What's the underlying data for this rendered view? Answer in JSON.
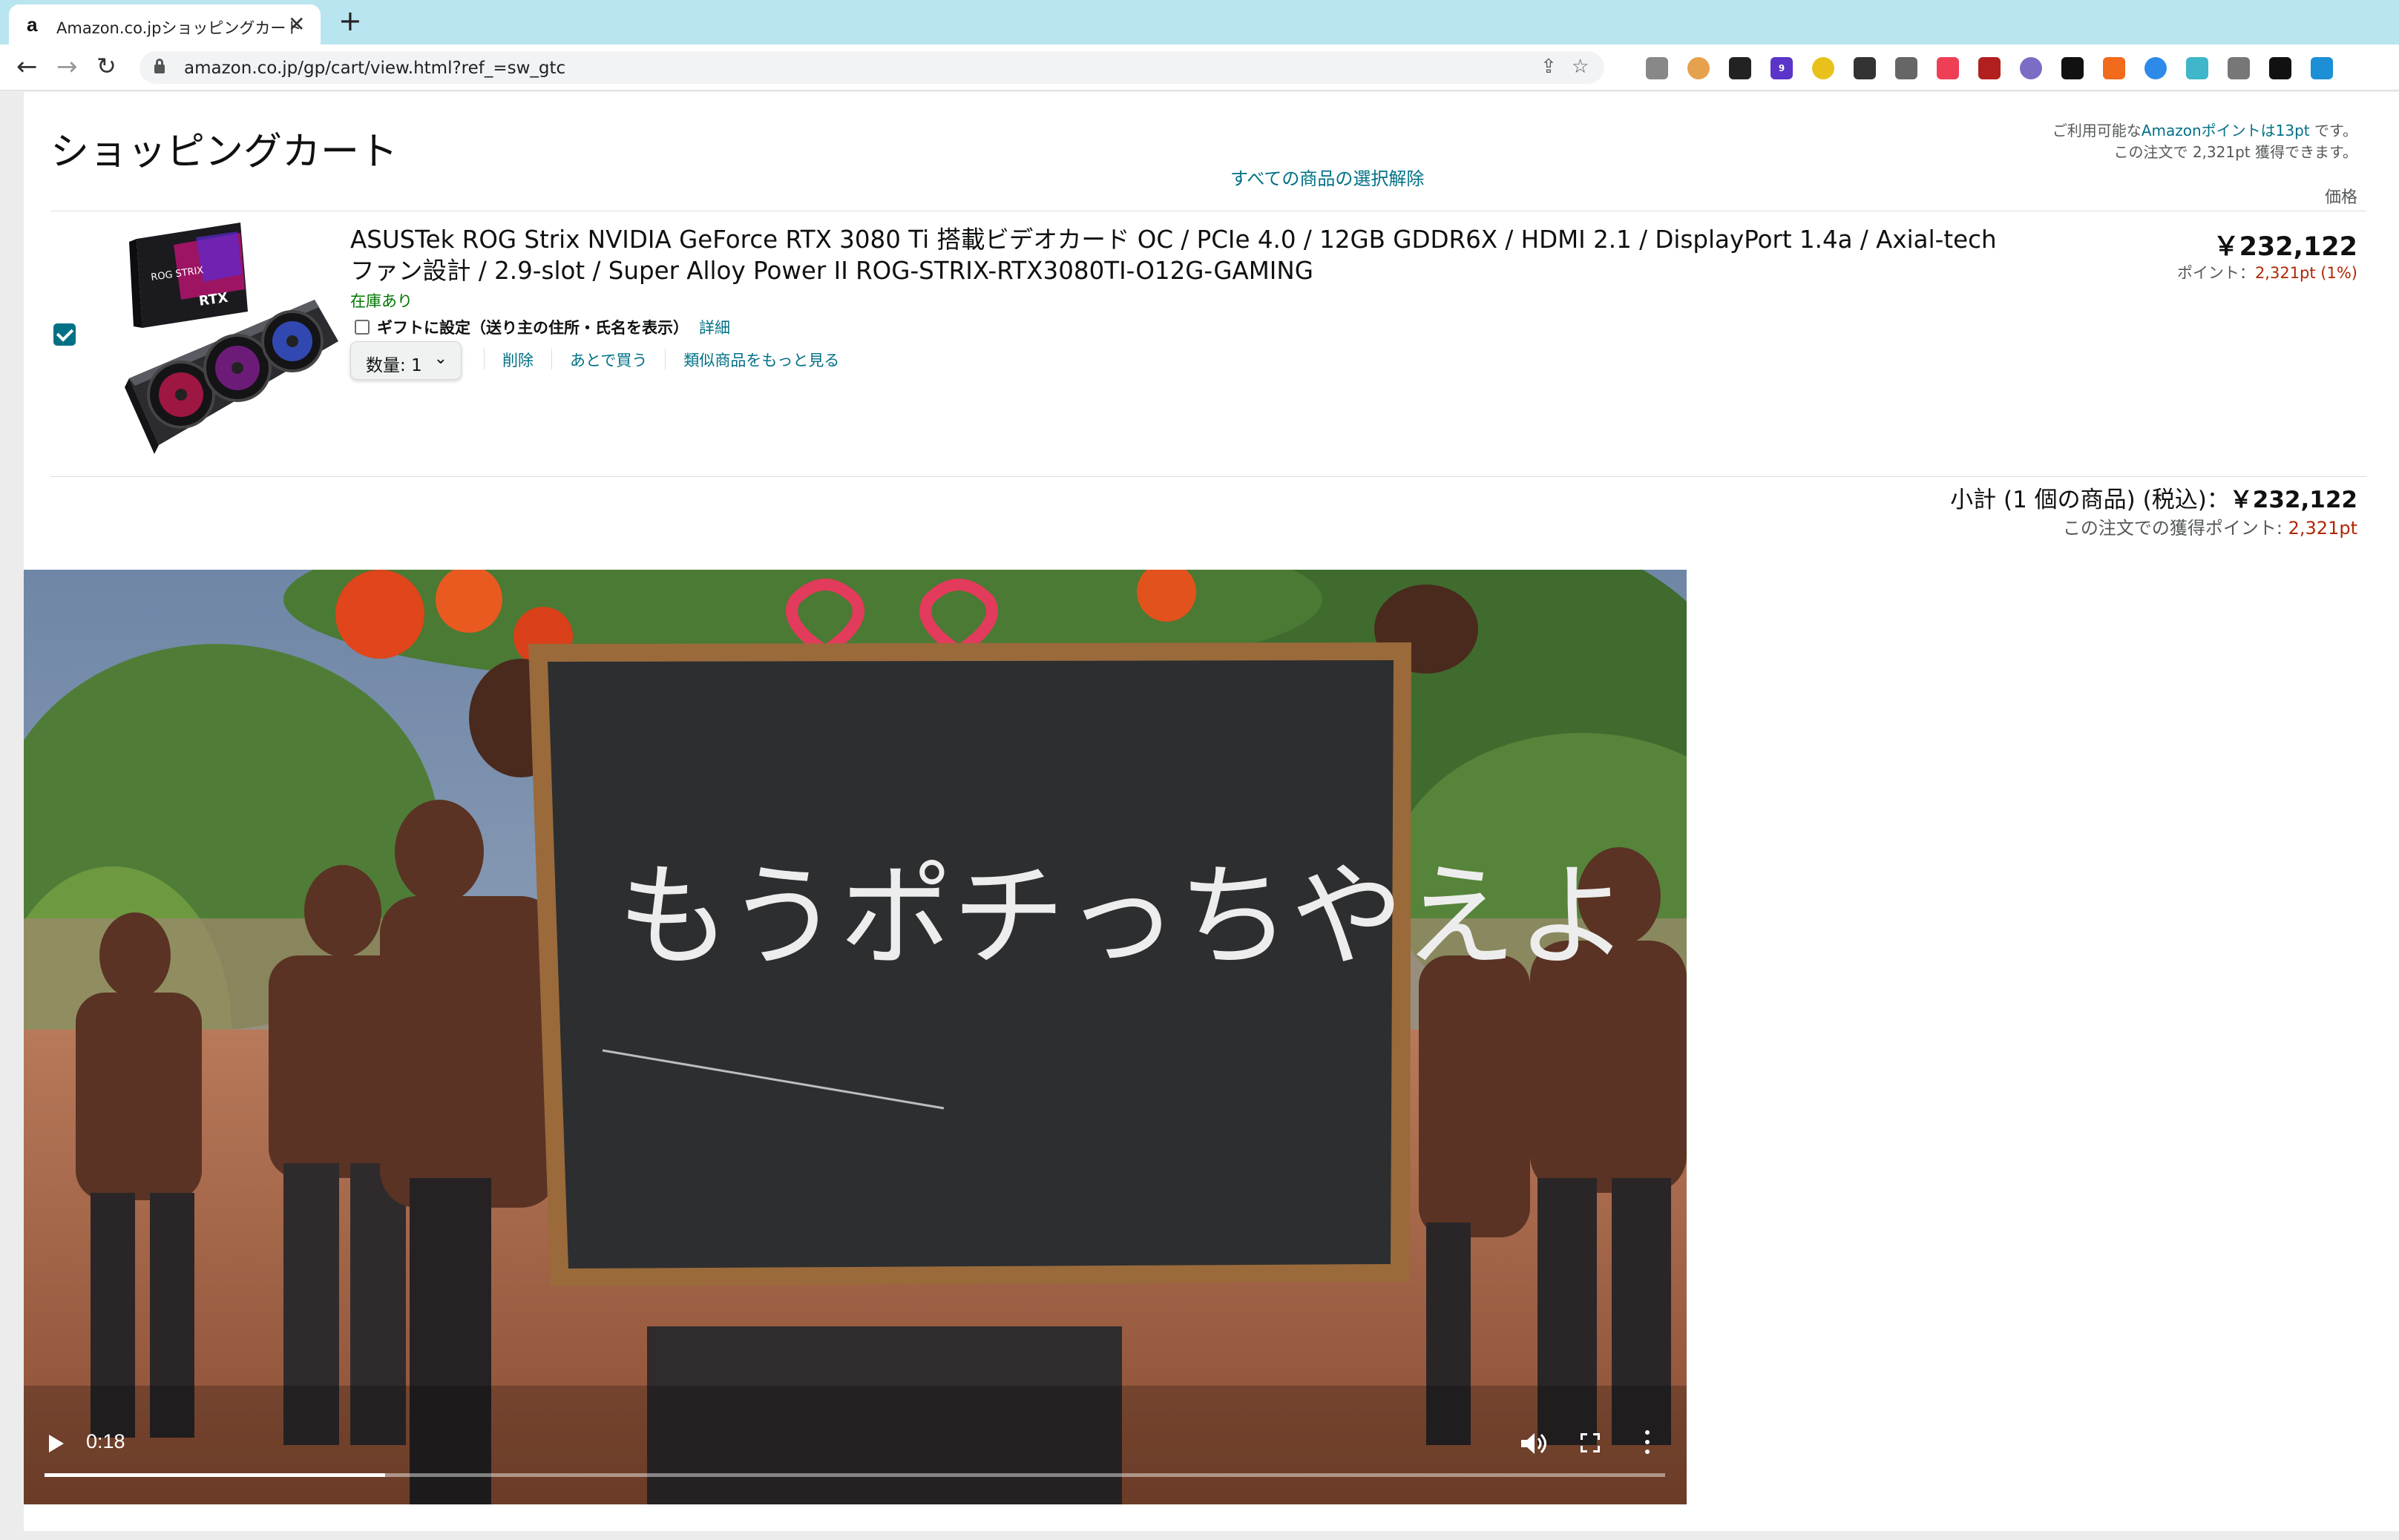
{
  "browser": {
    "tab": {
      "favicon": "a",
      "title": "Amazon.co.jpショッピングカート"
    },
    "new_tab_glyph": "+",
    "url": "amazon.co.jp/gp/cart/view.html?ref_=sw_gtc",
    "extensions": [
      "ext-1",
      "ext-2",
      "ext-3",
      "ext-4",
      "ext-5",
      "ext-6",
      "ext-7",
      "ext-8",
      "ext-9",
      "ext-10",
      "ext-11",
      "ext-12",
      "ext-13",
      "ext-14",
      "ext-15",
      "ext-16",
      "ext-17"
    ],
    "extension_badge": "9"
  },
  "cart": {
    "title": "ショッピングカート",
    "deselect_all": "すべての商品の選択解除",
    "points_note_line1_pre": "ご利用可能な",
    "points_note_line1_link": "Amazonポイントは13pt",
    "points_note_line1_post": " です。",
    "points_note_line2": "この注文で 2,321pt 獲得できます。",
    "price_header": "価格",
    "item": {
      "name": "ASUSTek ROG Strix NVIDIA GeForce RTX 3080 Ti 搭載ビデオカード OC / PCIe 4.0 / 12GB GDDR6X / HDMI 2.1 / DisplayPort 1.4a / Axial-tech ファン設計 / 2.9-slot / Super Alloy Power II ROG-STRIX-RTX3080TI-O12G-GAMING",
      "stock": "在庫あり",
      "gift_label": "ギフトに設定（送り主の住所・氏名を表示）",
      "gift_detail": "詳細",
      "quantity_label": "数量:",
      "quantity_value": "1",
      "action_delete": "削除",
      "action_save_later": "あとで買う",
      "action_similar": "類似商品をもっと見る",
      "price": "￥232,122",
      "points_label": "ポイント：",
      "points_value": "2,321pt (1%)",
      "box_text_top": "ROG STRIX",
      "box_text_brand": "RTX",
      "checked": true
    },
    "subtotal_label": "小計 (1 個の商品) (税込)：",
    "subtotal_value": "￥232,122",
    "subtotal_points_label": "この注文での獲得ポイント: ",
    "subtotal_points_value": "2,321pt"
  },
  "video": {
    "chalkboard_text": "もうポチっちやえよ",
    "time": "0:18",
    "progress": 0.21
  },
  "colors": {
    "tabstrip": "#b9e5f1",
    "link": "#007185",
    "price_red": "#b12704",
    "in_stock": "#007600"
  }
}
